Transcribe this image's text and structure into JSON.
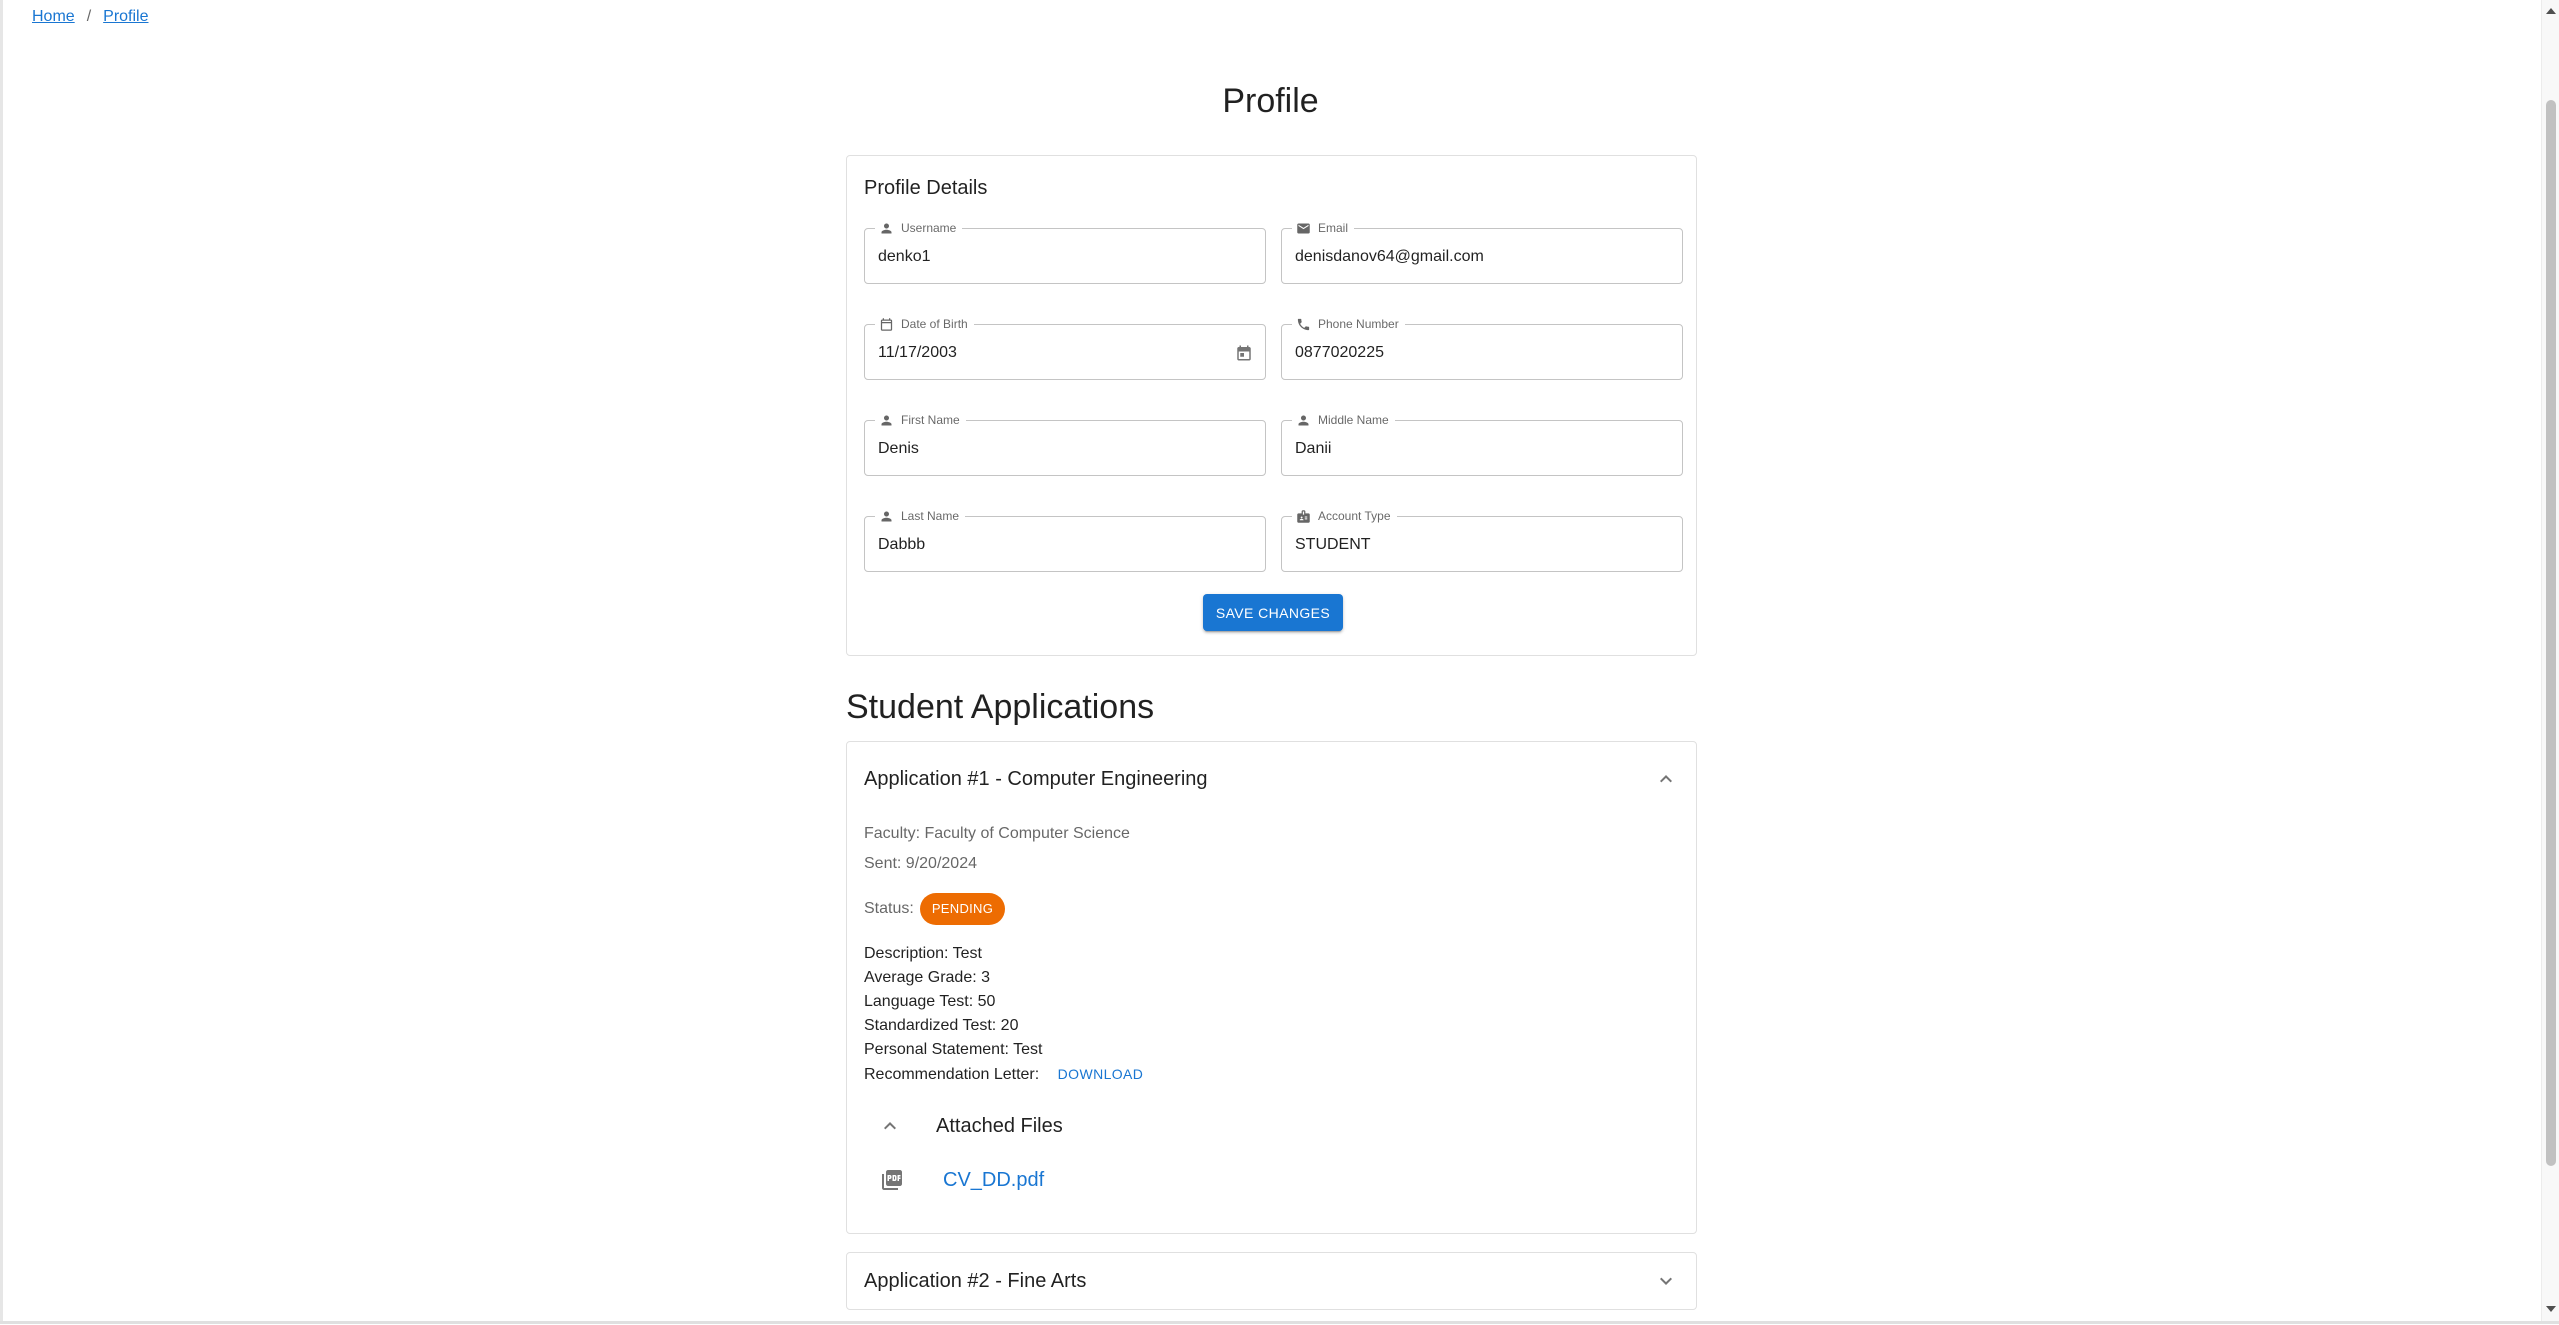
{
  "breadcrumb": {
    "home": "Home",
    "separator": "/",
    "current": "Profile"
  },
  "page": {
    "title": "Profile"
  },
  "profile": {
    "card_title": "Profile Details",
    "fields": {
      "username": {
        "label": "Username",
        "value": "denko1",
        "icon": "person-icon"
      },
      "email": {
        "label": "Email",
        "value": "denisdanov64@gmail.com",
        "icon": "email-icon"
      },
      "dob": {
        "label": "Date of Birth",
        "value": "11/17/2003",
        "icon": "calendar-icon"
      },
      "phone": {
        "label": "Phone Number",
        "value": "0877020225",
        "icon": "phone-icon"
      },
      "first_name": {
        "label": "First Name",
        "value": "Denis",
        "icon": "person-icon"
      },
      "middle_name": {
        "label": "Middle Name",
        "value": "Danii",
        "icon": "person-icon"
      },
      "last_name": {
        "label": "Last Name",
        "value": "Dabbb",
        "icon": "person-icon"
      },
      "account_type": {
        "label": "Account Type",
        "value": "STUDENT",
        "icon": "badge-icon"
      }
    },
    "save_label": "SAVE CHANGES"
  },
  "applications": {
    "section_title": "Student Applications",
    "items": [
      {
        "title": "Application #1 - Computer Engineering",
        "expanded": true,
        "faculty": "Faculty: Faculty of Computer Science",
        "sent": "Sent: 9/20/2024",
        "status_label": "Status:",
        "status": "PENDING",
        "description": "Description: Test",
        "average_grade": "Average Grade: 3",
        "language_test": "Language Test: 50",
        "standardized_test": "Standardized Test: 20",
        "personal_statement": "Personal Statement: Test",
        "recommendation_letter": "Recommendation Letter:",
        "download_label": "DOWNLOAD",
        "attached_files_label": "Attached Files",
        "files": [
          {
            "name": "CV_DD.pdf",
            "icon": "pdf-icon"
          }
        ]
      },
      {
        "title": "Application #2 - Fine Arts",
        "expanded": false
      }
    ]
  },
  "colors": {
    "primary": "#1976d2",
    "status_pending": "#ed6c02",
    "border": "#c4c4c4"
  }
}
